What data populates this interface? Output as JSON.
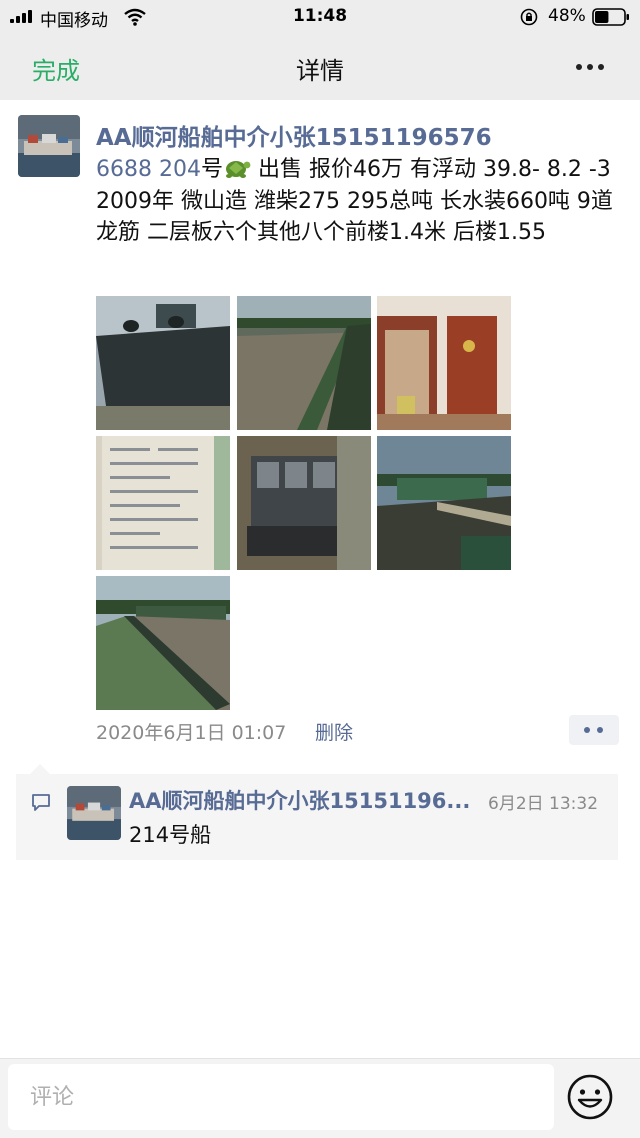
{
  "status_bar": {
    "carrier": "中国移动",
    "time": "11:48",
    "battery": "48%",
    "battery_level": 0.48,
    "icons": [
      "signal-icon",
      "wifi-icon",
      "orientation-lock-icon",
      "battery-icon"
    ]
  },
  "nav": {
    "left": "完成",
    "title": "详情",
    "right_icon": "more-dots-icon"
  },
  "post": {
    "author": "AA顺河船舶中介小张15151196576",
    "text_prefix": "6688  204",
    "text_main": "号",
    "emoji": "turtle-icon",
    "text_rest": " 出售 报价46万 有浮动 39.8- 8.2 -3   2009年 微山造 潍柴275  295总吨  长水装660吨 9道龙筋 二层板六个其他八个前楼1.4米 后楼1.55",
    "photos": [
      {
        "name": "photo-ship-hull"
      },
      {
        "name": "photo-cargo-hold"
      },
      {
        "name": "photo-cabin-interior"
      },
      {
        "name": "photo-certificate-document"
      },
      {
        "name": "photo-engine"
      },
      {
        "name": "photo-deck-view"
      },
      {
        "name": "photo-hold-side"
      }
    ],
    "time": "2020年6月1日 01:07",
    "delete": "删除"
  },
  "comments": [
    {
      "author": "AA顺河船舶中介小张15151196...",
      "time": "6月2日 13:32",
      "text": "214号船"
    }
  ],
  "input": {
    "placeholder": "评论"
  },
  "colors": {
    "accent_green": "#2aae67",
    "link_blue": "#576b95",
    "header_bg": "#ededed"
  }
}
